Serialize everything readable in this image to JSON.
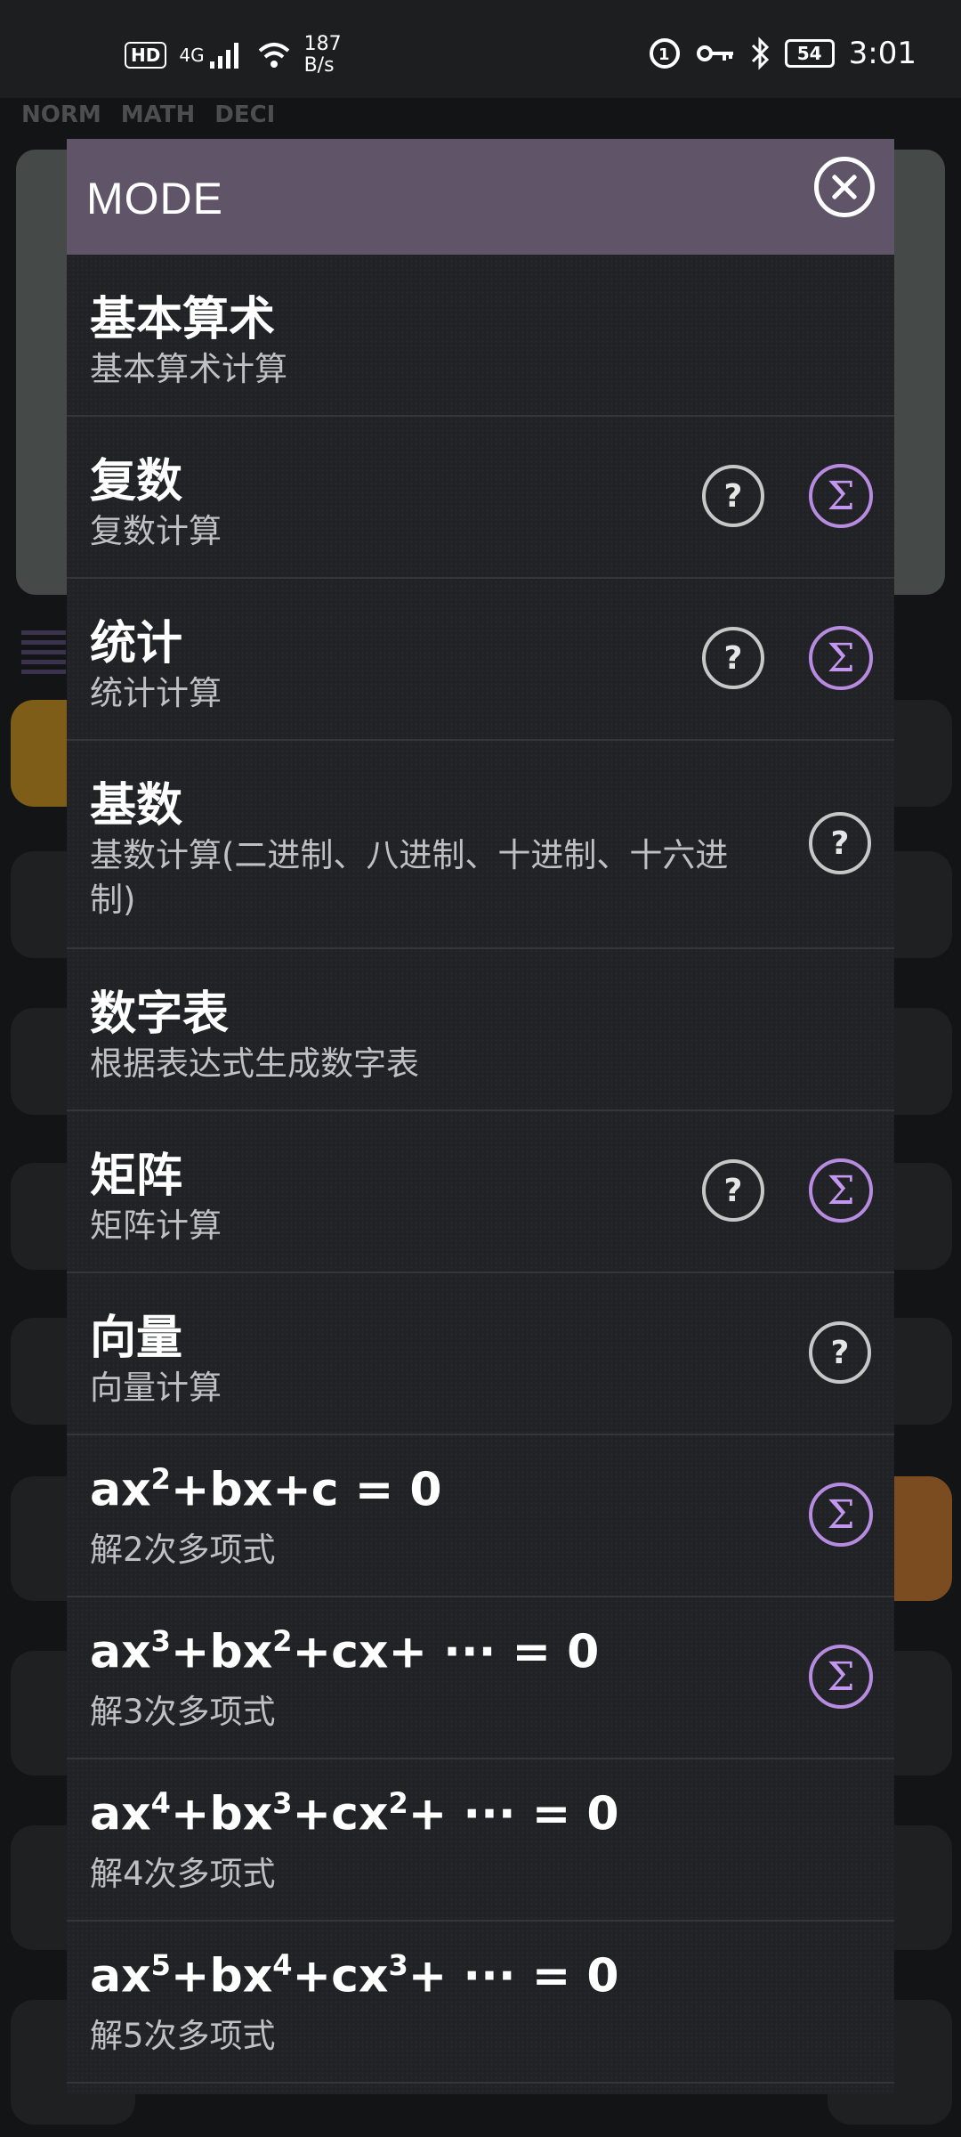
{
  "status_bar": {
    "hd": "HD",
    "network": "4G",
    "speed_value": "187",
    "speed_unit": "B/s",
    "battery": "54",
    "time": "3:01"
  },
  "calculator_bg": {
    "mode_labels": [
      "NORM",
      "MATH",
      "DECI"
    ]
  },
  "dialog": {
    "title": "MODE",
    "items": [
      {
        "title": "基本算术",
        "subtitle": "基本算术计算"
      },
      {
        "title": "复数",
        "subtitle": "复数计算"
      },
      {
        "title": "统计",
        "subtitle": "统计计算"
      },
      {
        "title": "基数",
        "subtitle": "基数计算(二进制、八进制、十进制、十六进制)"
      },
      {
        "title": "数字表",
        "subtitle": "根据表达式生成数字表"
      },
      {
        "title": "矩阵",
        "subtitle": "矩阵计算"
      },
      {
        "title": "向量",
        "subtitle": "向量计算"
      },
      {
        "title_parts": [
          "ax",
          "2",
          "+bx+c = 0"
        ],
        "subtitle": "解2次多项式"
      },
      {
        "title_parts": [
          "ax",
          "3",
          "+bx",
          "2",
          "+cx+ ··· = 0"
        ],
        "subtitle": "解3次多项式"
      },
      {
        "title_parts": [
          "ax",
          "4",
          "+bx",
          "3",
          "+cx",
          "2",
          "+ ··· = 0"
        ],
        "subtitle": "解4次多项式"
      },
      {
        "title_parts": [
          "ax",
          "5",
          "+bx",
          "4",
          "+cx",
          "3",
          "+ ··· = 0"
        ],
        "subtitle": "解5次多项式"
      }
    ],
    "help_glyph": "?",
    "sigma_glyph": "Σ"
  },
  "colors": {
    "header": "#5f5468",
    "sigma_accent": "#b78be0",
    "dialog_bg": "#202225"
  }
}
